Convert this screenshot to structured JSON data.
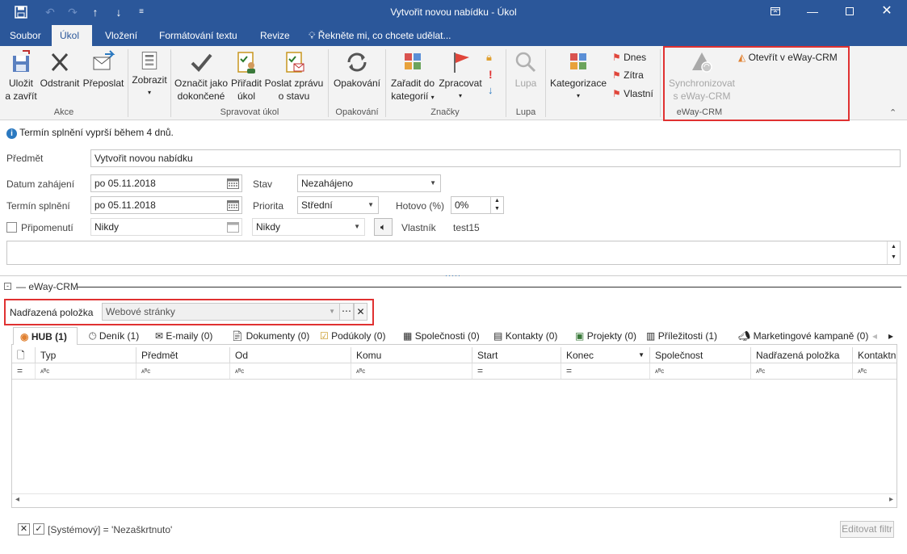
{
  "window": {
    "title": "Vytvořit novou nabídku - Úkol",
    "quick_access": [
      "save-icon",
      "undo-icon",
      "redo-icon",
      "up-icon",
      "down-icon",
      "customize-icon"
    ]
  },
  "tabs": [
    "Soubor",
    "Úkol",
    "Vložení",
    "Formátování textu",
    "Revize",
    "Řekněte mi, co chcete udělat..."
  ],
  "ribbon": {
    "akce": {
      "label": "Akce",
      "save": [
        "Uložit",
        "a zavřít"
      ],
      "delete": "Odstranit",
      "forward": "Přeposlat"
    },
    "zobrazit": {
      "label": "Zobrazit"
    },
    "spravovat": {
      "label": "Spravovat úkol",
      "mark": [
        "Označit jako",
        "dokončené"
      ],
      "assign": [
        "Přiřadit",
        "úkol"
      ],
      "send": [
        "Poslat zprávu",
        "o stavu"
      ]
    },
    "opakovani": {
      "label": "Opakování",
      "btn": "Opakování"
    },
    "znacky": {
      "label": "Značky",
      "categorize": [
        "Zařadit do",
        "kategorií"
      ],
      "followup": "Zpracovat"
    },
    "lupa": {
      "label": "Lupa",
      "btn": "Lupa"
    },
    "kategorizace": {
      "btn": "Kategorizace",
      "today": "Dnes",
      "tomorrow": "Zítra",
      "custom": "Vlastní"
    },
    "eway": {
      "label": "eWay-CRM",
      "sync": [
        "Synchronizovat",
        "s eWay-CRM"
      ],
      "open": "Otevřít v eWay-CRM"
    }
  },
  "info": "Termín splnění vyprší během 4 dnů.",
  "form": {
    "subject_label": "Předmět",
    "subject": "Vytvořit novou nabídku",
    "start_label": "Datum zahájení",
    "start": "po 05.11.2018",
    "due_label": "Termín splnění",
    "due": "po 05.11.2018",
    "reminder_label": "Připomenutí",
    "reminder_date": "Nikdy",
    "reminder_time": "Nikdy",
    "status_label": "Stav",
    "status": "Nezahájeno",
    "priority_label": "Priorita",
    "priority": "Střední",
    "done_label": "Hotovo (%)",
    "done": "0%",
    "owner_label": "Vlastník",
    "owner": "test15"
  },
  "eway": {
    "section_title": "eWay-CRM",
    "parent_label": "Nadřazená položka",
    "parent_value": "Webové stránky",
    "tabs": [
      {
        "label": "HUB (1)"
      },
      {
        "label": "Deník (1)"
      },
      {
        "label": "E-maily (0)"
      },
      {
        "label": "Dokumenty (0)"
      },
      {
        "label": "Podúkoly (0)"
      },
      {
        "label": "Společnosti (0)"
      },
      {
        "label": "Kontakty (0)"
      },
      {
        "label": "Projekty (0)"
      },
      {
        "label": "Příležitosti (1)"
      },
      {
        "label": "Marketingové kampaně (0)"
      }
    ],
    "columns": [
      "Typ",
      "Předmět",
      "Od",
      "Komu",
      "Start",
      "Konec",
      "Společnost",
      "Nadřazená položka",
      "Kontaktní o"
    ],
    "filter": "[Systémový] = 'Nezaškrtnuto'",
    "edit_filter": "Editovat filtr"
  },
  "colors": {
    "accent": "#2b579a",
    "highlight": "#e03131"
  }
}
